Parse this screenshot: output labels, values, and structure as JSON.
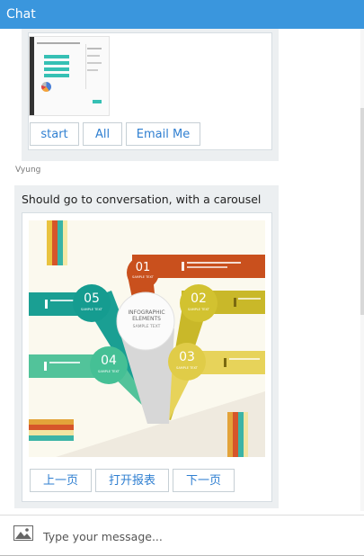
{
  "header": {
    "title": "Chat"
  },
  "messages": [
    {
      "buttons": [
        "start",
        "All",
        "Email Me"
      ]
    },
    {
      "sender": "Vyung",
      "text": "Should go to conversation, with a carousel",
      "buttons": [
        "上一页",
        "打开报表",
        "下一页"
      ]
    }
  ],
  "infographic": {
    "title": "INFOGRAPHIC",
    "subtitle": "ELEMENTS",
    "tag": "SAMPLE TEXT",
    "steps": [
      {
        "num": "01",
        "label": "SAMPLE TEXT",
        "color": "#d2541c"
      },
      {
        "num": "02",
        "label": "SAMPLE TEXT",
        "color": "#d8c83a"
      },
      {
        "num": "03",
        "label": "SAMPLE TEXT",
        "color": "#e8d24a"
      },
      {
        "num": "04",
        "label": "SAMPLE TEXT",
        "color": "#3fbf96"
      },
      {
        "num": "05",
        "label": "SAMPLE TEXT",
        "color": "#1ea69a"
      }
    ]
  },
  "composer": {
    "placeholder": "Type your message..."
  }
}
